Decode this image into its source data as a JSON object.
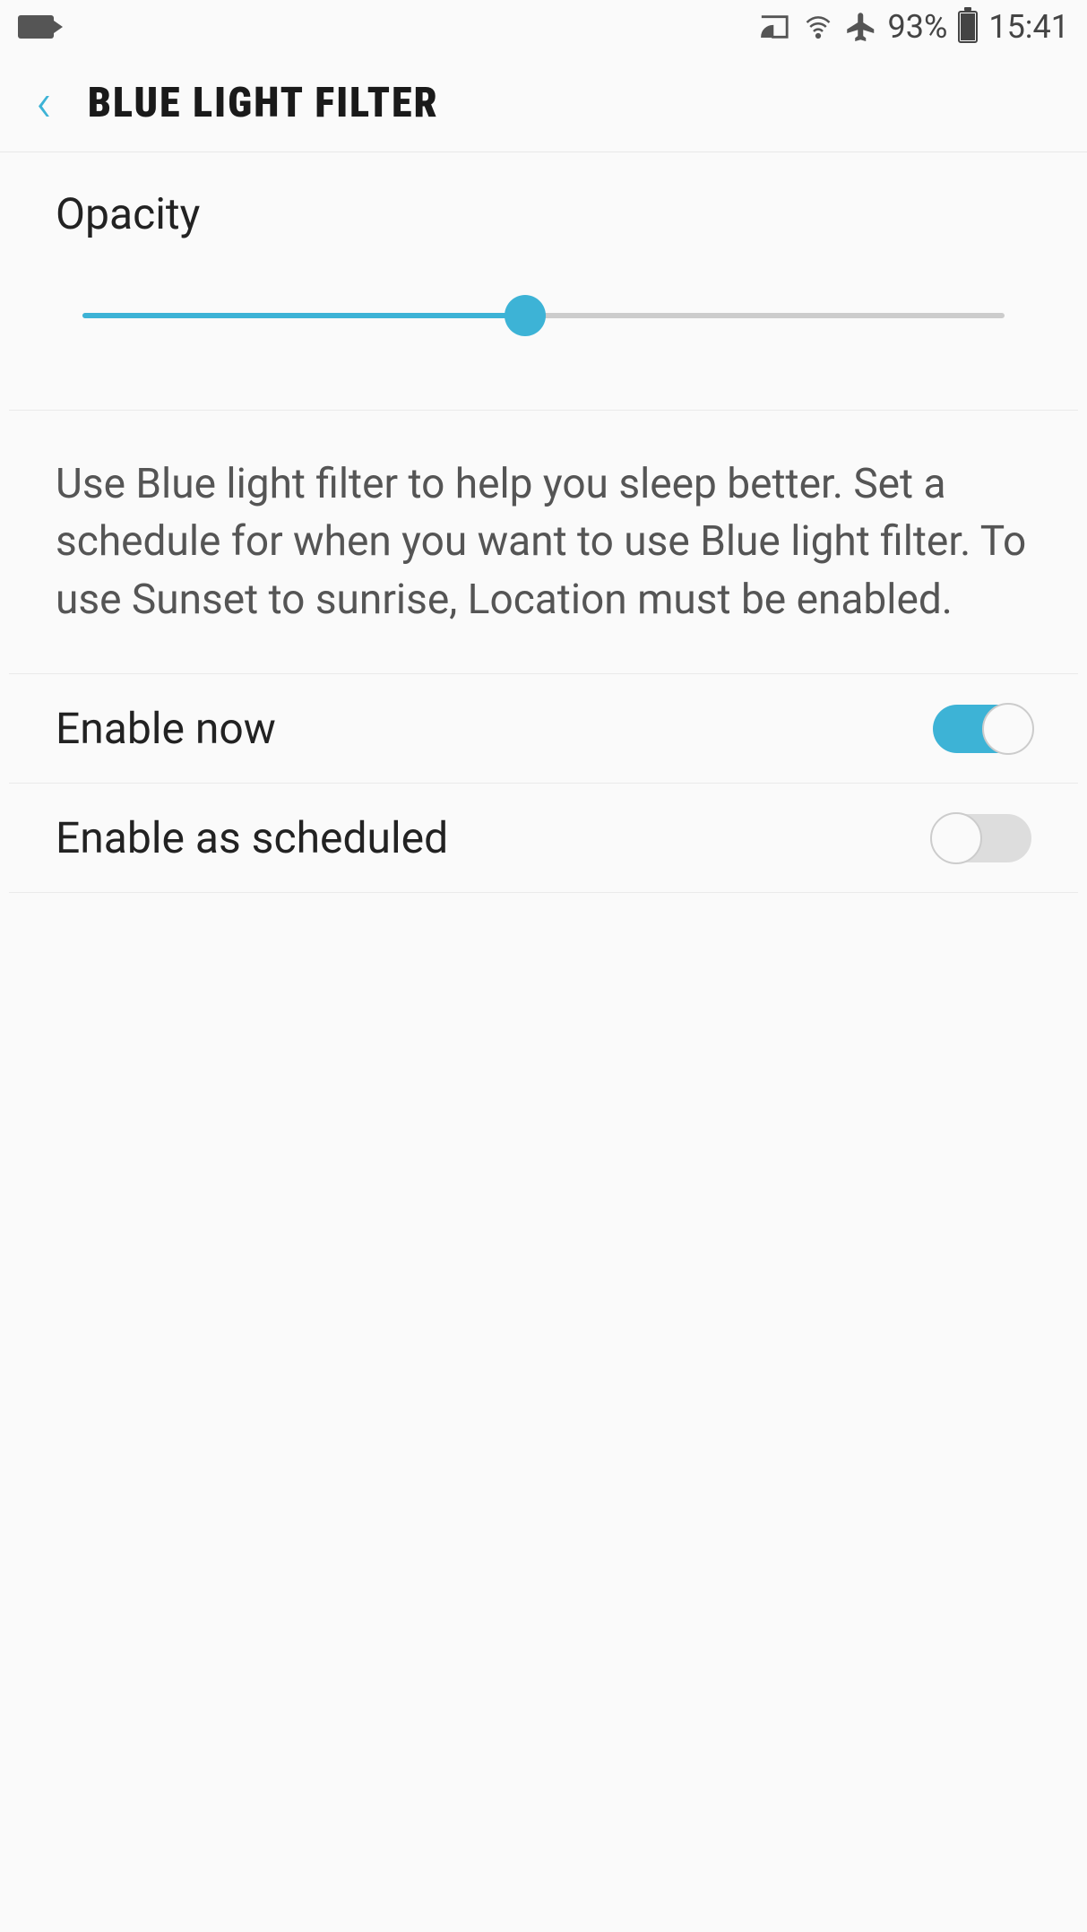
{
  "status_bar": {
    "battery_percent": "93%",
    "time": "15:41"
  },
  "header": {
    "title": "BLUE LIGHT FILTER"
  },
  "opacity": {
    "label": "Opacity",
    "value": 48
  },
  "description": "Use Blue light filter to help you sleep better. Set a schedule for when you want to use Blue light filter. To use Sunset to sunrise, Location must be enabled.",
  "enable_now": {
    "label": "Enable now",
    "on": true
  },
  "enable_scheduled": {
    "label": "Enable as scheduled",
    "on": false
  }
}
